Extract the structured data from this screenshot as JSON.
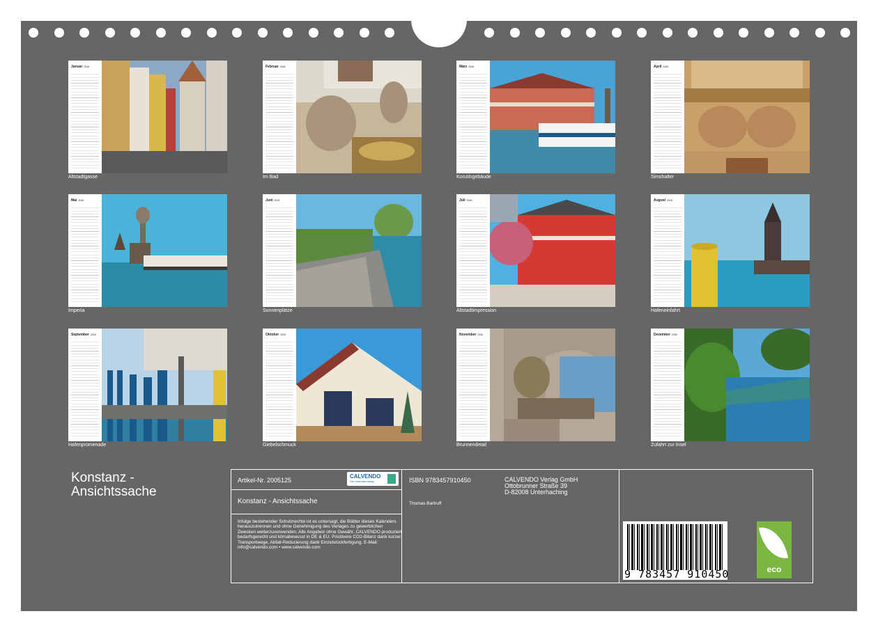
{
  "months": [
    {
      "name": "Januar",
      "year": "2026",
      "caption": "Altstadtgasse"
    },
    {
      "name": "Februar",
      "year": "2026",
      "caption": "Im Bad"
    },
    {
      "name": "März",
      "year": "2026",
      "caption": "Konzilsgebäude"
    },
    {
      "name": "April",
      "year": "2026",
      "caption": "Simshalter"
    },
    {
      "name": "Mai",
      "year": "2026",
      "caption": "Imperia"
    },
    {
      "name": "Juni",
      "year": "2026",
      "caption": "Sonnenplätze"
    },
    {
      "name": "Juli",
      "year": "2026",
      "caption": "Altstadtimpression"
    },
    {
      "name": "August",
      "year": "2026",
      "caption": "Hafeneinfahrt"
    },
    {
      "name": "September",
      "year": "2026",
      "caption": "Hafenpromenade"
    },
    {
      "name": "Oktober",
      "year": "2026",
      "caption": "Giebelschmuck"
    },
    {
      "name": "November",
      "year": "2026",
      "caption": "Brunnendetail"
    },
    {
      "name": "Dezember",
      "year": "2026",
      "caption": "Zufahrt zur Insel"
    }
  ],
  "cover_title": "Konstanz - Ansichtssache",
  "info": {
    "article": "Artikel-Nr. 2005125",
    "logo_text": "CALVENDO",
    "logo_sub": "Der Kalenderverlag",
    "product_title": "Konstanz - Ansichtssache",
    "legal": "Infolge bestehender Schutzrechte ist es untersagt, die Blätter dieses Kalenders herauszutrennen und ohne Genehmigung des Verlages zu gewerblichen Zwecken weiterzuverwenden. Alle Angaben ohne Gewähr. CALVENDO produziert bedarfsgerecht und klimabewusst in DE & EU. Positivere CO2-Bilanz dank kurzer Transportwege, Abfall-Reduzierung dank Einzelstückfertigung. E-Mail: info@calvendo.com • www.calvendo.com",
    "isbn": "ISBN 9783457910450",
    "author": "Thomas Bartruff",
    "publisher": [
      "CALVENDO Verlag GmbH",
      "Ottobrunner Straße 39",
      "D-82008 Unterhaching"
    ],
    "barcode_number": "9 783457 910450",
    "eco_label": "eco"
  }
}
